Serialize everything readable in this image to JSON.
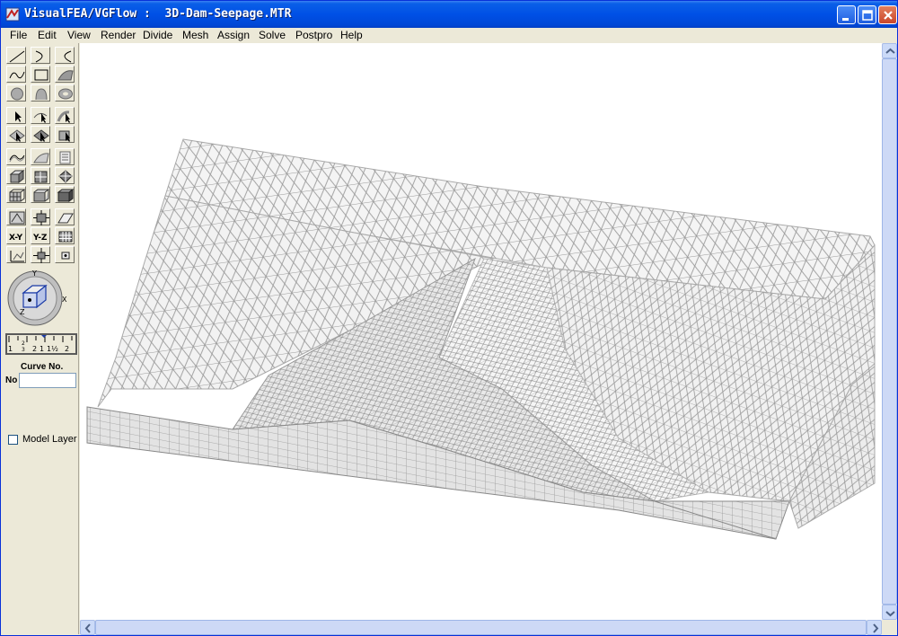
{
  "window": {
    "title": "VisualFEA/VGFlow :  3D-Dam-Seepage.MTR",
    "controls": [
      "minimize-icon",
      "maximize-icon",
      "close-icon"
    ]
  },
  "menu": [
    "File",
    "Edit",
    "View",
    "Render",
    "Divide",
    "Mesh",
    "Assign",
    "Solve",
    "Postpro",
    "Help"
  ],
  "toolbox": {
    "ruler_labels": [
      "1",
      "2",
      "1",
      "1½",
      "2"
    ],
    "ruler_fracs": [
      "2",
      "3"
    ],
    "curve_label": "Curve No.",
    "no_label": "No",
    "curve_value": "",
    "model_layer_label": "Model Layer",
    "model_layer_checked": false,
    "view_cube_axes": [
      "Y",
      "X",
      "Z"
    ]
  },
  "viewport": {
    "content": "3D dam seepage finite element mesh wireframe",
    "mesh_color": "#9a9a9a"
  },
  "colors": {
    "title_bar": "#0054e3",
    "face": "#ece9d8"
  }
}
